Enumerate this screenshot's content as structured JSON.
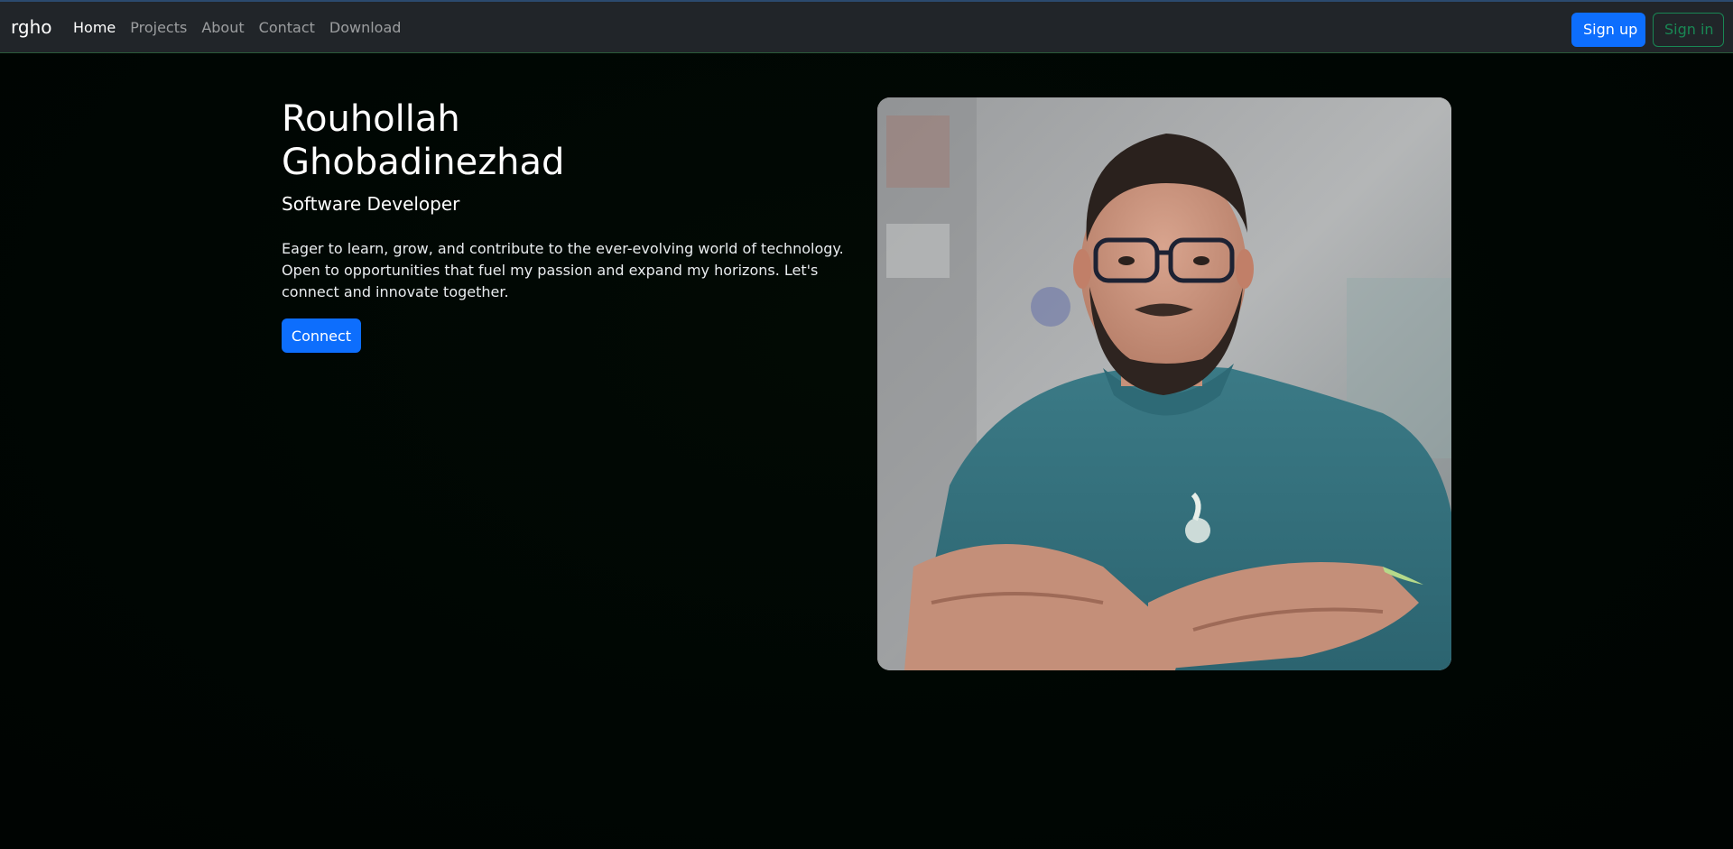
{
  "navbar": {
    "brand": "rgho",
    "links": [
      {
        "label": "Home",
        "active": true
      },
      {
        "label": "Projects",
        "active": false
      },
      {
        "label": "About",
        "active": false
      },
      {
        "label": "Contact",
        "active": false
      },
      {
        "label": "Download",
        "active": false
      }
    ],
    "signup_label": "Sign up",
    "signin_label": "Sign in"
  },
  "hero": {
    "name": "Rouhollah Ghobadinezhad",
    "subtitle": "Software Developer",
    "description": "Eager to learn, grow, and contribute to the ever-evolving world of technology. Open to opportunities that fuel my passion and expand my horizons. Let's connect and innovate together.",
    "cta_label": "Connect"
  },
  "colors": {
    "navbar_bg": "#212529",
    "primary": "#0d6efd",
    "success": "#198754",
    "page_bg": "#000603"
  }
}
